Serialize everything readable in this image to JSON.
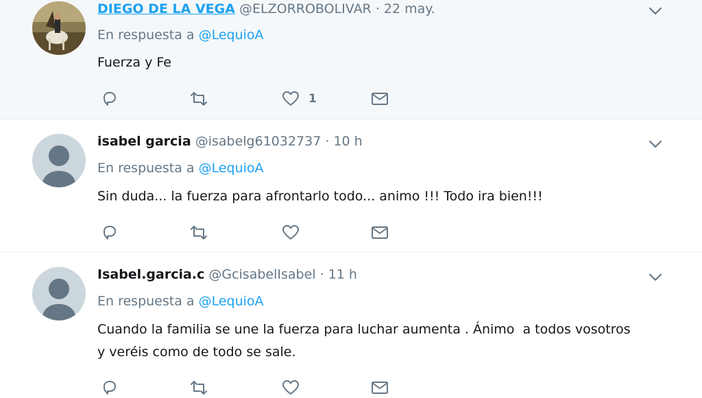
{
  "tweets": [
    {
      "name": "DIEGO DE LA VEGA",
      "handle": "@ELZORROBOLIVAR",
      "dot": "·",
      "time": "22 may.",
      "reply_prefix": "En respuesta a",
      "reply_mention": "@LequioA",
      "text": "Fuerza y Fe",
      "like_count": "1",
      "avatar": "painting-avatar"
    },
    {
      "name": "isabel garcia",
      "handle": "@isabelg61032737",
      "dot": "·",
      "time": "10 h",
      "reply_prefix": "En respuesta a",
      "reply_mention": "@LequioA",
      "text": "Sin duda... la fuerza para afrontarlo todo... animo !!! Todo ira bien!!!",
      "like_count": "",
      "avatar": "default-avatar"
    },
    {
      "name": "Isabel.garcia.c",
      "handle": "@GcisabelIsabel",
      "dot": "·",
      "time": "11 h",
      "reply_prefix": "En respuesta a",
      "reply_mention": "@LequioA",
      "text_line1": "Cuando la familia se une la fuerza para luchar aumenta . Ánimo  a todos vosotros",
      "text_line2": "y veréis como de todo se sale.",
      "like_count": "",
      "avatar": "default-avatar"
    }
  ],
  "icons": {
    "reply": "reply-icon",
    "retweet": "retweet-icon",
    "like": "heart-icon",
    "message": "envelope-icon",
    "caret": "chevron-down-icon"
  },
  "colors": {
    "link": "#1da1f2",
    "secondary": "#657786",
    "highlight_bg": "#f5f8fa",
    "divider": "#e6ecf0"
  }
}
